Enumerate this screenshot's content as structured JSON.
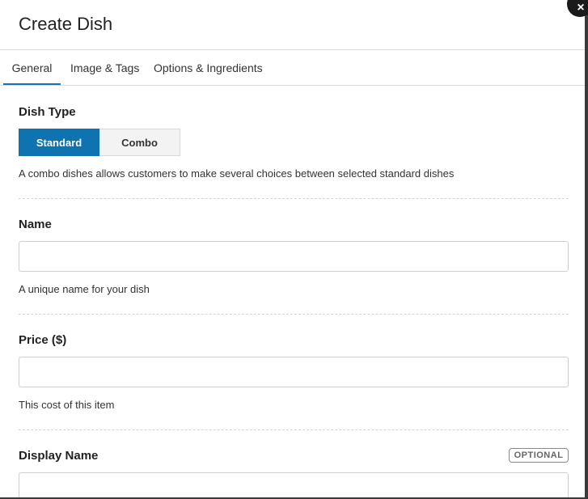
{
  "modal": {
    "title": "Create Dish",
    "close_label": "×"
  },
  "tabs": [
    {
      "label": "General",
      "active": true
    },
    {
      "label": "Image & Tags",
      "active": false
    },
    {
      "label": "Options & Ingredients",
      "active": false
    }
  ],
  "dish_type": {
    "label": "Dish Type",
    "options": [
      {
        "label": "Standard",
        "selected": true
      },
      {
        "label": "Combo",
        "selected": false
      }
    ],
    "help": "A combo dishes allows customers to make several choices between selected standard dishes"
  },
  "name": {
    "label": "Name",
    "value": "",
    "help": "A unique name for your dish"
  },
  "price": {
    "label": "Price ($)",
    "value": "",
    "help": "This cost of this item"
  },
  "display_name": {
    "label": "Display Name",
    "badge": "OPTIONAL",
    "value": ""
  },
  "colors": {
    "accent": "#0f72b1",
    "backdrop": "#3a3a3a"
  }
}
